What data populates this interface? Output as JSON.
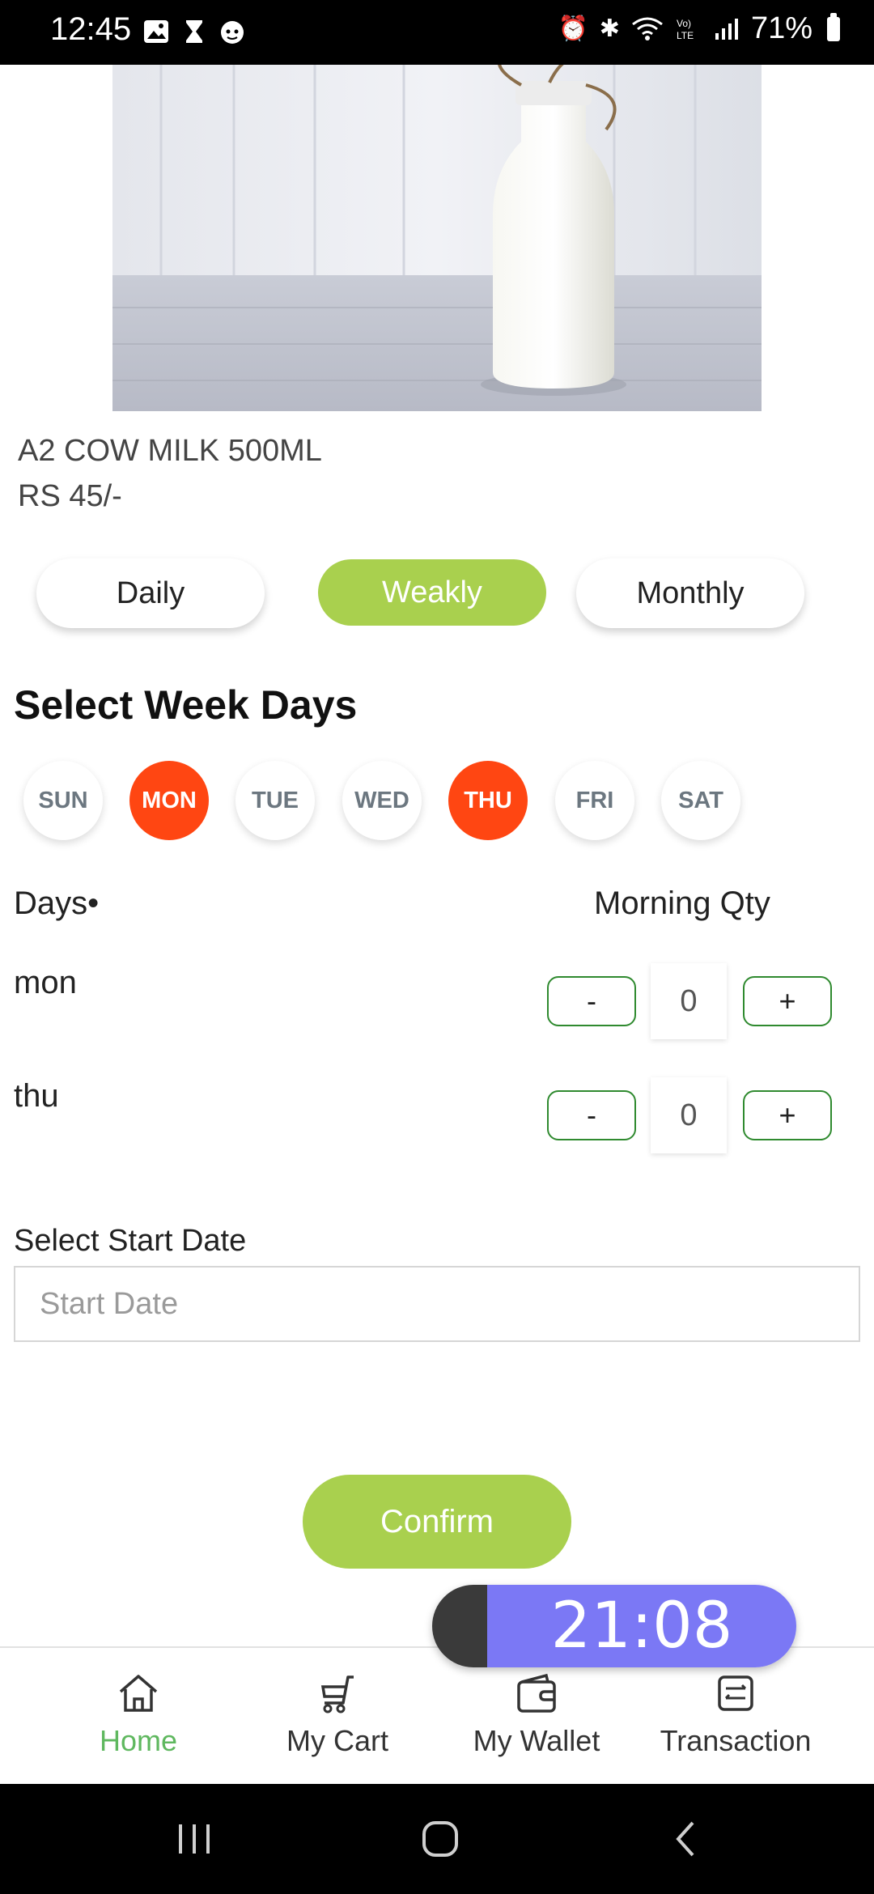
{
  "status_bar": {
    "time": "12:45",
    "battery": "71%",
    "left_icons": [
      "image-icon",
      "hourglass-icon",
      "cat-icon"
    ],
    "right_icons": [
      "alarm-icon",
      "bluetooth-icon",
      "wifi-icon",
      "volte-icon",
      "signal-icon",
      "battery-icon"
    ]
  },
  "product": {
    "name": "A2 COW MILK 500ML",
    "price": "RS 45/-"
  },
  "frequency": {
    "options": [
      "Daily",
      "Weakly",
      "Monthly"
    ],
    "selected": "Weakly",
    "colors": {
      "active": "#a9d04e"
    }
  },
  "week_days": {
    "title": "Select Week Days",
    "days": [
      "SUN",
      "MON",
      "TUE",
      "WED",
      "THU",
      "FRI",
      "SAT"
    ],
    "selected": [
      "MON",
      "THU"
    ],
    "colors": {
      "active": "#ff4612",
      "inactive_text": "#6c7780"
    }
  },
  "quantity_table": {
    "col_days": "Days•",
    "col_qty": "Morning Qty",
    "rows": [
      {
        "day": "mon",
        "qty": "0",
        "minus": "-",
        "plus": "+"
      },
      {
        "day": "thu",
        "qty": "0",
        "minus": "-",
        "plus": "+"
      }
    ]
  },
  "start_date": {
    "label": "Select Start Date",
    "placeholder": "Start Date",
    "value": ""
  },
  "confirm_label": "Confirm",
  "timer": {
    "value": "21:08"
  },
  "bottom_nav": {
    "items": [
      {
        "label": "Home",
        "icon": "home-icon",
        "active": true
      },
      {
        "label": "My Cart",
        "icon": "cart-icon",
        "active": false
      },
      {
        "label": "My Wallet",
        "icon": "wallet-icon",
        "active": false
      },
      {
        "label": "Transaction",
        "icon": "transaction-icon",
        "active": false
      }
    ],
    "active_color": "#5fb85f"
  },
  "system_nav": [
    "recents-icon",
    "home-circle-icon",
    "back-icon"
  ]
}
